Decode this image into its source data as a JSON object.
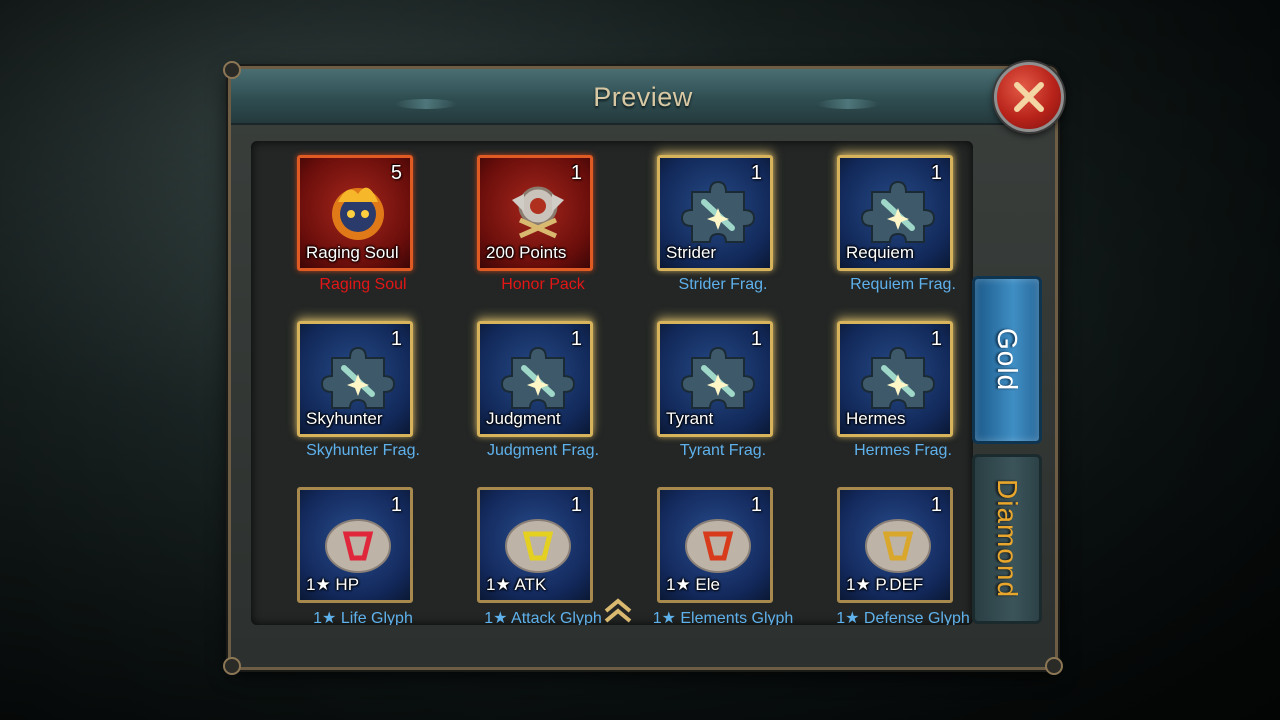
{
  "dialog": {
    "title": "Preview"
  },
  "tabs": [
    {
      "label": "Gold",
      "selected": true
    },
    {
      "label": "Diamond",
      "selected": false
    }
  ],
  "items": [
    {
      "icon_label": "Raging Soul",
      "count": "5",
      "name": "Raging Soul",
      "frame": "red",
      "name_color": "red",
      "art": "flaming-skull-icon"
    },
    {
      "icon_label": "200 Points",
      "count": "1",
      "name": "Honor Pack",
      "frame": "red",
      "name_color": "red",
      "art": "shield-crest-icon"
    },
    {
      "icon_label": "Strider",
      "count": "1",
      "name": "Strider Frag.",
      "frame": "gold",
      "name_color": "blue",
      "art": "puzzle-piece-icon"
    },
    {
      "icon_label": "Requiem",
      "count": "1",
      "name": "Requiem Frag.",
      "frame": "gold",
      "name_color": "blue",
      "art": "puzzle-piece-icon"
    },
    {
      "icon_label": "Skyhunter",
      "count": "1",
      "name": "Skyhunter Frag.",
      "frame": "gold",
      "name_color": "blue",
      "art": "puzzle-piece-icon"
    },
    {
      "icon_label": "Judgment",
      "count": "1",
      "name": "Judgment Frag.",
      "frame": "gold",
      "name_color": "blue",
      "art": "puzzle-piece-icon"
    },
    {
      "icon_label": "Tyrant",
      "count": "1",
      "name": "Tyrant Frag.",
      "frame": "gold",
      "name_color": "blue",
      "art": "puzzle-piece-icon"
    },
    {
      "icon_label": "Hermes",
      "count": "1",
      "name": "Hermes Frag.",
      "frame": "gold",
      "name_color": "blue",
      "art": "puzzle-piece-icon"
    },
    {
      "icon_label": "1★ HP",
      "count": "1",
      "name": "1★ Life Glyph",
      "frame": "blue",
      "name_color": "blue",
      "art": "rune-stone-icon",
      "rune_color": "#e0263a"
    },
    {
      "icon_label": "1★ ATK",
      "count": "1",
      "name": "1★ Attack Glyph",
      "frame": "blue",
      "name_color": "blue",
      "art": "rune-stone-icon",
      "rune_color": "#e4d020"
    },
    {
      "icon_label": "1★ Ele",
      "count": "1",
      "name": "1★ Elements Glyph",
      "frame": "blue",
      "name_color": "blue",
      "art": "rune-stone-icon",
      "rune_color": "#d83a1c"
    },
    {
      "icon_label": "1★ P.DEF",
      "count": "1",
      "name": "1★ Defense Glyph",
      "frame": "blue",
      "name_color": "blue",
      "art": "rune-stone-icon",
      "rune_color": "#d9a72c"
    }
  ],
  "colors": {
    "red_name": "#e31616",
    "blue_name": "#5fb1ec",
    "title": "#d8c9a4",
    "diamond_tab_text": "#e8a62c"
  }
}
